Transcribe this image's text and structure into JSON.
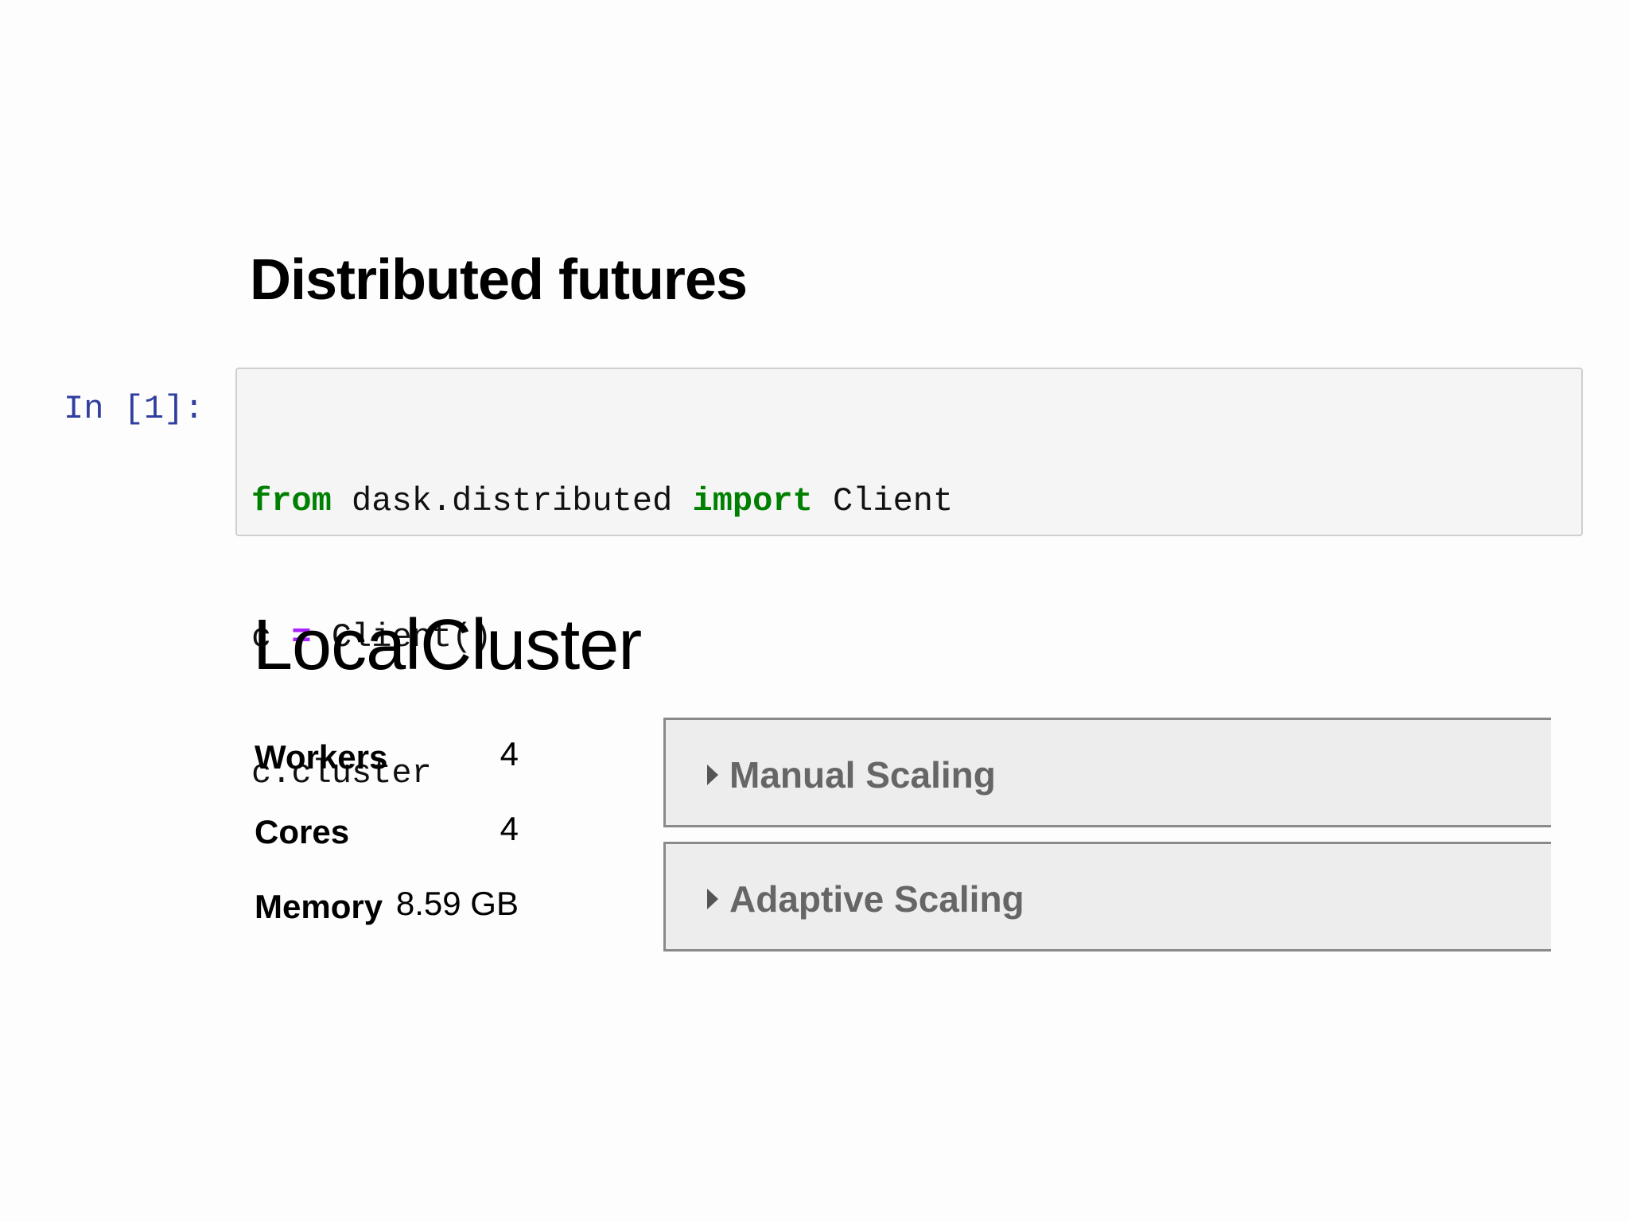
{
  "markdown": {
    "heading": "Distributed futures"
  },
  "code_cell": {
    "prompt": "In [1]:",
    "lines": [
      {
        "kw1": "from",
        "mid": " dask.distributed ",
        "kw2": "import",
        "rest": " Client"
      },
      {
        "pre": "c ",
        "op": "=",
        "post": " Client()"
      },
      {
        "text": "c.cluster"
      }
    ]
  },
  "output": {
    "title": "LocalCluster",
    "stats": [
      {
        "label": "Workers",
        "value": "4"
      },
      {
        "label": "Cores",
        "value": "4"
      },
      {
        "label": "Memory",
        "value": "8.59 GB"
      }
    ],
    "accordions": [
      {
        "label": "Manual Scaling",
        "icon": "caret-right-icon"
      },
      {
        "label": "Adaptive Scaling",
        "icon": "caret-right-icon"
      }
    ]
  },
  "colors": {
    "keyword": "#008000",
    "operator": "#aa22ff",
    "prompt": "#303f9f",
    "code_background": "#f6f5f6",
    "accordion_background": "#eeedee"
  }
}
